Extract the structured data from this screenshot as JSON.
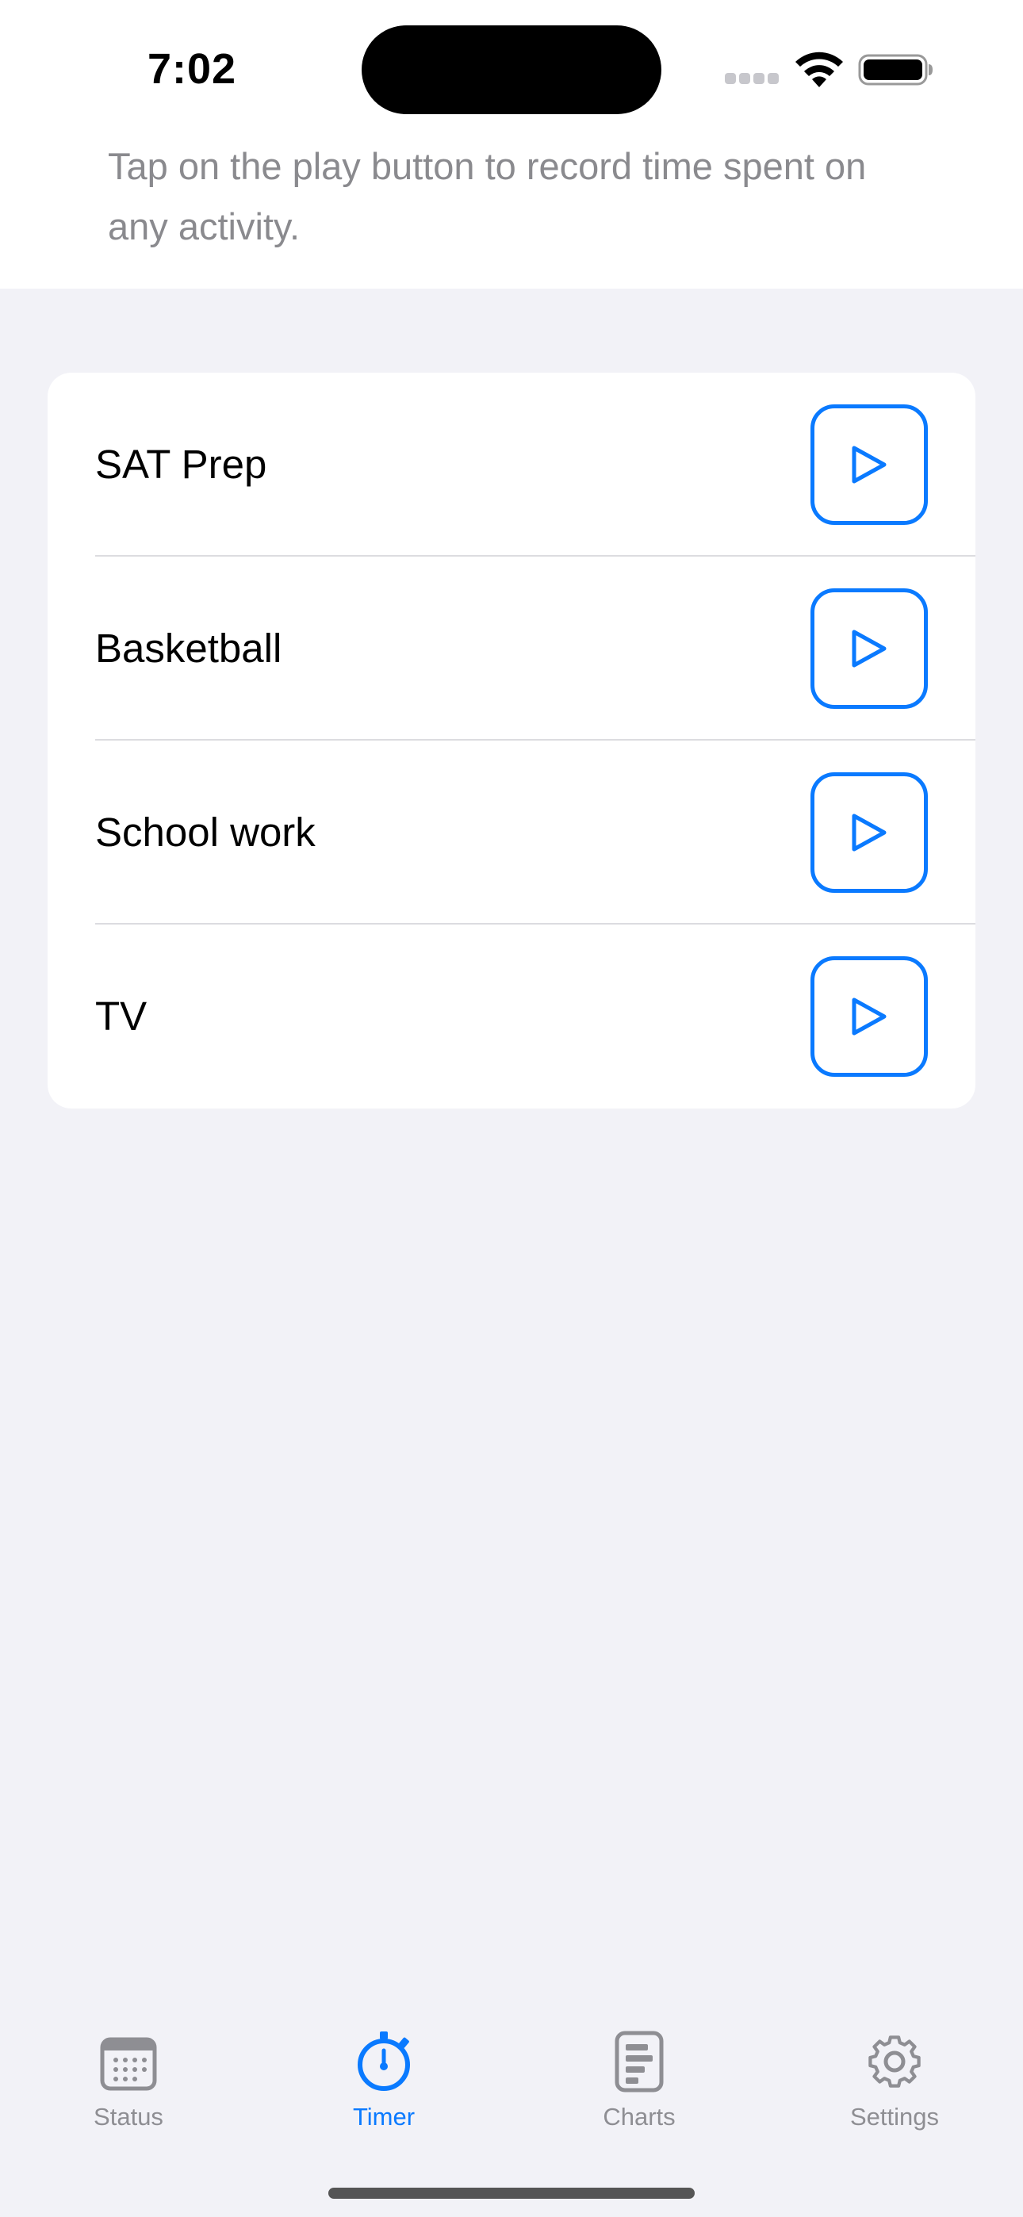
{
  "status_bar": {
    "time": "7:02"
  },
  "hint": "Tap on the play button to record time spent on any activity.",
  "activities": [
    {
      "label": "SAT Prep"
    },
    {
      "label": "Basketball"
    },
    {
      "label": "School work"
    },
    {
      "label": "TV"
    }
  ],
  "tabbar": {
    "items": [
      {
        "label": "Status",
        "icon": "calendar-icon",
        "active": false
      },
      {
        "label": "Timer",
        "icon": "stopwatch-icon",
        "active": true
      },
      {
        "label": "Charts",
        "icon": "chart-icon",
        "active": false
      },
      {
        "label": "Settings",
        "icon": "gear-icon",
        "active": false
      }
    ]
  },
  "colors": {
    "accent": "#0a7aff",
    "inactive": "#8e8e93",
    "background": "#f2f2f7"
  }
}
